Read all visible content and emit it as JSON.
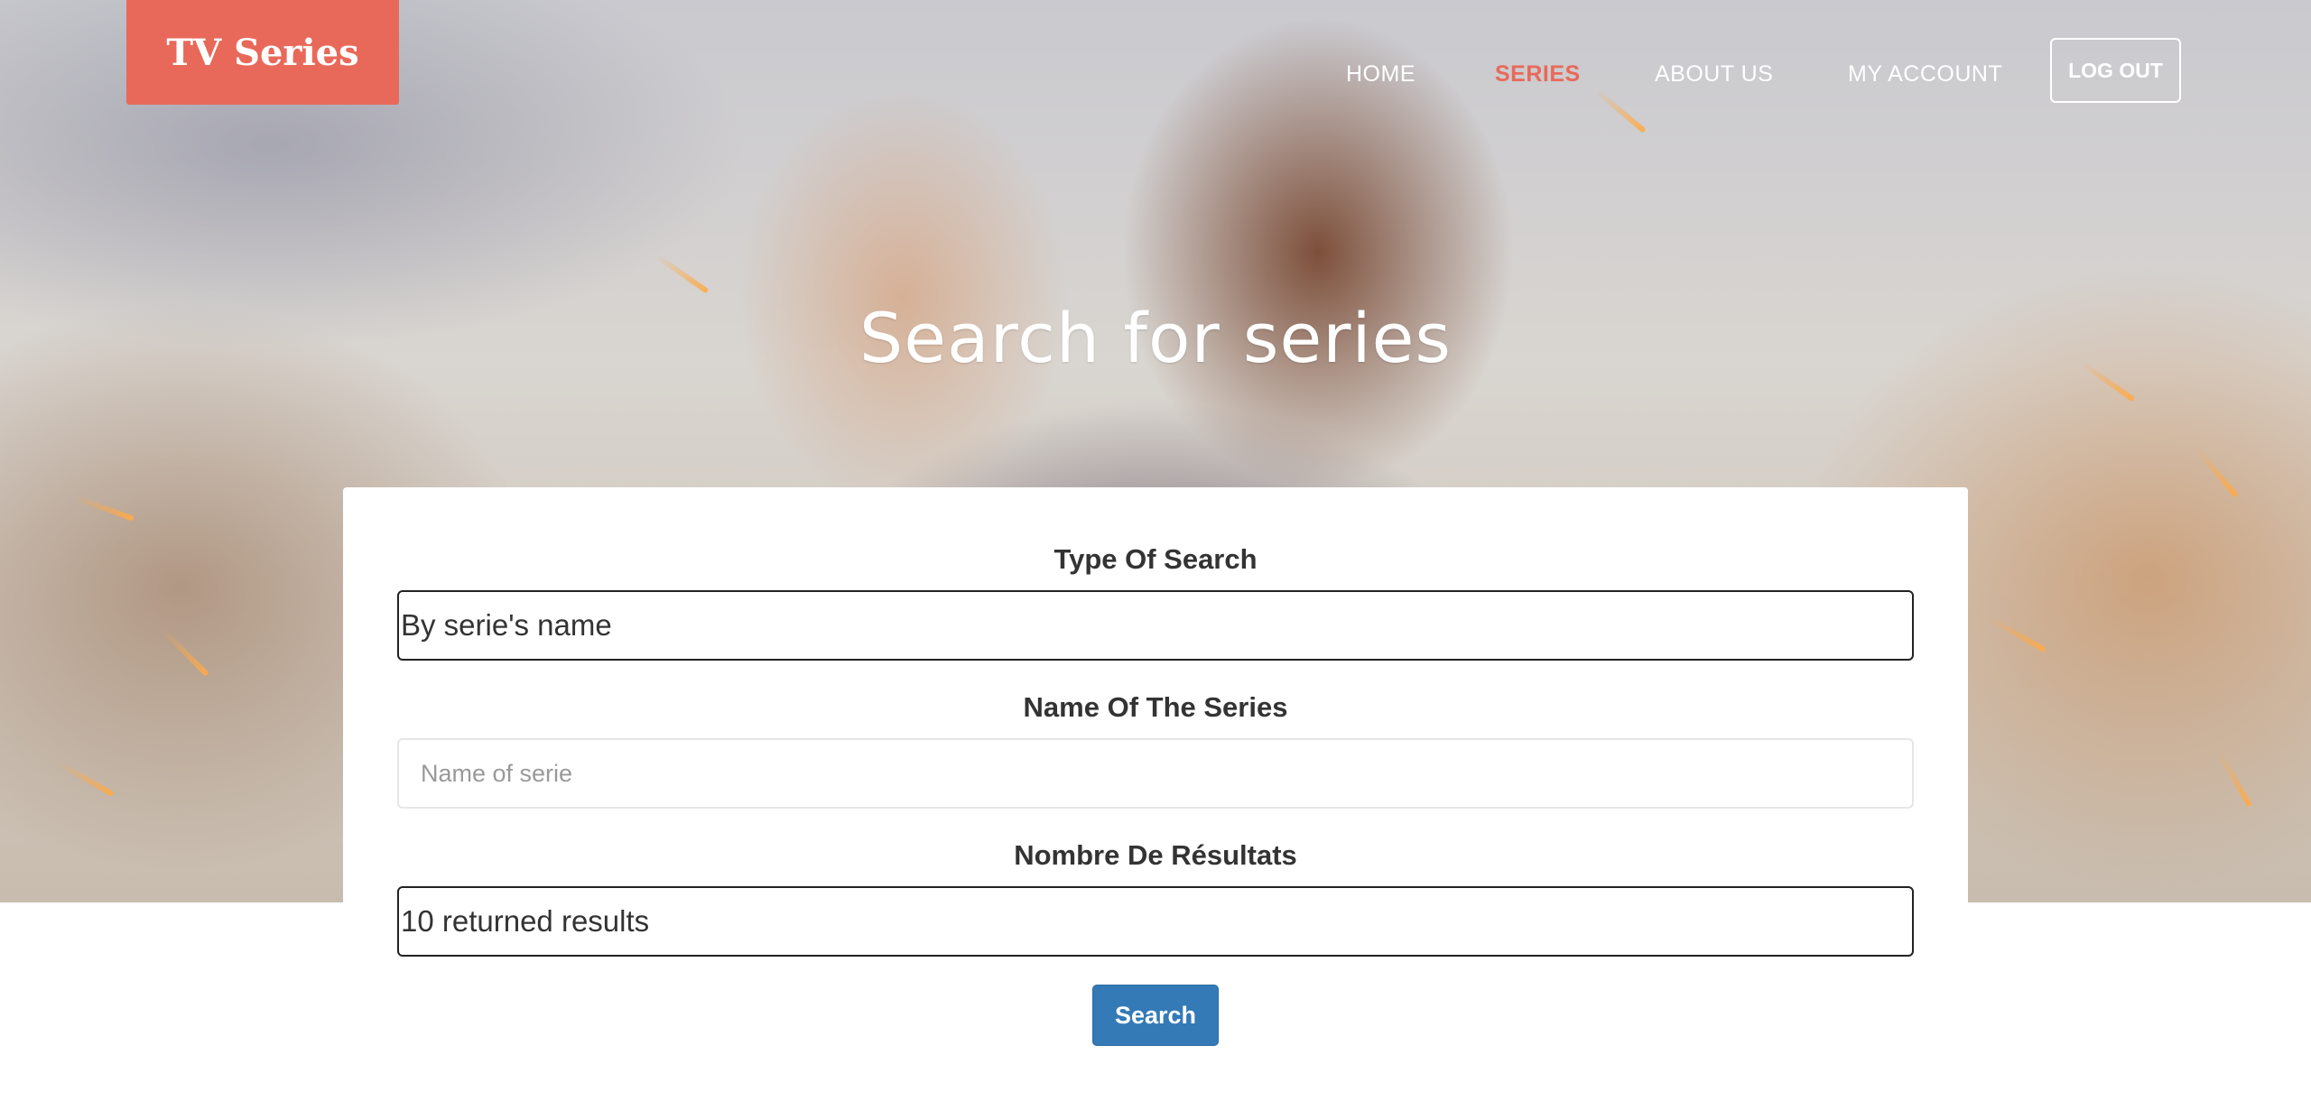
{
  "header": {
    "logo": "TV Series",
    "nav": [
      {
        "label": "HOME",
        "active": false
      },
      {
        "label": "SERIES",
        "active": true
      },
      {
        "label": "ABOUT US",
        "active": false
      },
      {
        "label": "MY ACCOUNT",
        "active": false
      }
    ],
    "logout": "LOG OUT"
  },
  "hero": {
    "title": "Search for series"
  },
  "form": {
    "type_label": "Type Of Search",
    "type_value": "By serie's name",
    "name_label": "Name Of The Series",
    "name_placeholder": "Name of serie",
    "name_value": "",
    "results_label": "Nombre De Résultats",
    "results_value": "10 returned results",
    "search_button": "Search"
  },
  "colors": {
    "accent": "#e8695a",
    "button": "#337ab7"
  }
}
